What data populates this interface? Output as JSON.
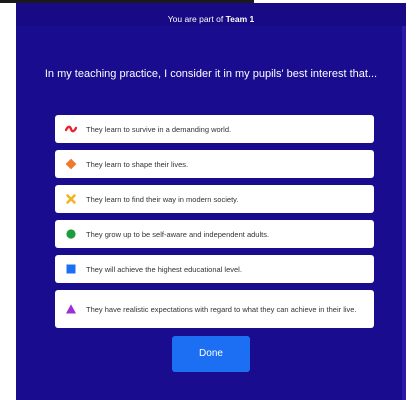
{
  "header": {
    "prefix": "You are part of",
    "team": "Team 1"
  },
  "question": "In my teaching practice, I consider it in my pupils' best interest that...",
  "options": [
    {
      "icon": "red-wave-icon",
      "label": "They learn to survive in a demanding world.",
      "color": "#e8232f"
    },
    {
      "icon": "orange-diamond-icon",
      "label": "They learn to shape their lives.",
      "color": "#f07a2b"
    },
    {
      "icon": "yellow-cross-icon",
      "label": "They learn to find their way in modern society.",
      "color": "#f4b323"
    },
    {
      "icon": "green-circle-icon",
      "label": "They grow up to be self-aware and independent adults.",
      "color": "#1e9b3c"
    },
    {
      "icon": "blue-square-icon",
      "label": "They will achieve the highest educational level.",
      "color": "#1b6ff2"
    },
    {
      "icon": "purple-triangle-icon",
      "label": "They have realistic expectations with regard to what they can achieve in their live.",
      "color": "#9b2fd6"
    }
  ],
  "done_label": "Done",
  "colors": {
    "panel_bg": "#1a0c8f",
    "button_bg": "#1c6ff2"
  }
}
